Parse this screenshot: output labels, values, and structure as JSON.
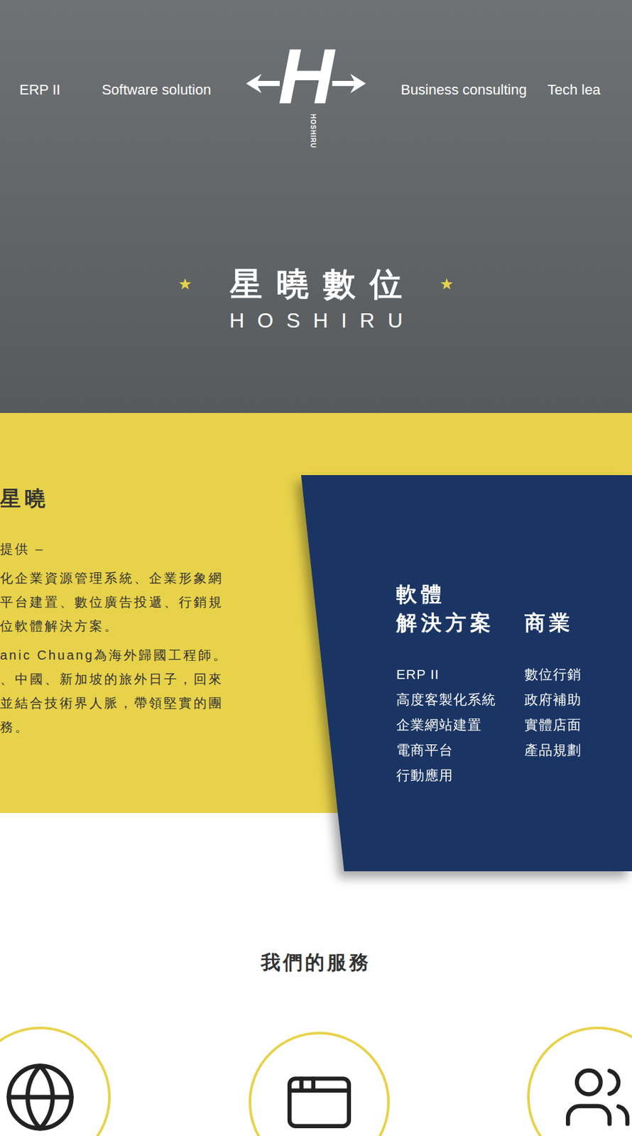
{
  "nav": {
    "left": [
      "ERP II",
      "Software solution"
    ],
    "right": [
      "Business consulting",
      "Tech lea"
    ]
  },
  "logo": {
    "letter": "H",
    "subtext": "HOSHIRU"
  },
  "hero": {
    "title": "星曉數位",
    "subtitle": "HOSHIRU",
    "star": "★"
  },
  "about": {
    "heading": "星曉",
    "lines": [
      [
        {
          "text": "提供 –"
        }
      ],
      [
        {
          "text": "化企業資源管理系統、企業形象網"
        },
        {
          "text": "平台建置、數位廣告投遞、行銷規"
        },
        {
          "text": "位軟體解決方案。"
        }
      ],
      [
        {
          "text": "anic Chuang為海外歸國工程師。"
        },
        {
          "text": "、中國、新加坡的旅外日子，回來"
        },
        {
          "text": "並結合技術界人脈，帶領堅實的團"
        },
        {
          "text": "務。"
        }
      ]
    ]
  },
  "solutions": [
    {
      "heading": [
        "軟體",
        "解決方案"
      ],
      "items": [
        "ERP II",
        "高度客製化系統",
        "企業網站建置",
        "電商平台",
        "行動應用"
      ]
    },
    {
      "heading": [
        "商業"
      ],
      "items": [
        "數位行銷",
        "政府補助",
        "實體店面",
        "產品規劃"
      ]
    }
  ],
  "services": {
    "title": "我們的服務"
  }
}
